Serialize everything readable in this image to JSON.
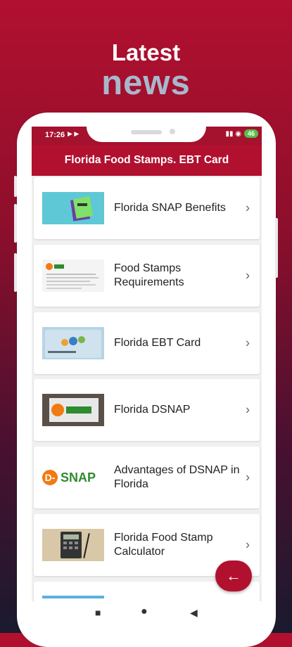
{
  "hero": {
    "line1": "Latest",
    "line2": "news"
  },
  "status_bar": {
    "time": "17:26",
    "left_icons": "▶ ▶",
    "right_icons": "▮▮ ◉",
    "battery": "46"
  },
  "app_bar": {
    "title": "Florida Food Stamps. EBT Card"
  },
  "items": [
    {
      "title": "Florida SNAP Benefits",
      "thumb": "snap-note-image"
    },
    {
      "title": "Food Stamps Requirements",
      "thumb": "snap-document-image"
    },
    {
      "title": "Florida EBT Card",
      "thumb": "ebt-card-image"
    },
    {
      "title": "Florida DSNAP",
      "thumb": "dsnap-laptop-image"
    },
    {
      "title": "Advantages of DSNAP in Florida",
      "thumb": "dsnap-logo-image"
    },
    {
      "title": "Florida Food Stamp Calculator",
      "thumb": "calculator-image"
    }
  ],
  "dsnap_logo": {
    "d": "D-",
    "snap": "SNAP"
  },
  "fab": {
    "icon": "arrow-left-icon",
    "glyph": "←"
  },
  "nav": {
    "recents": "■",
    "home": "●",
    "back": "◀"
  },
  "colors": {
    "primary": "#b2102f",
    "accent_green": "#2e8b2e",
    "logo_orange": "#f27a12"
  }
}
